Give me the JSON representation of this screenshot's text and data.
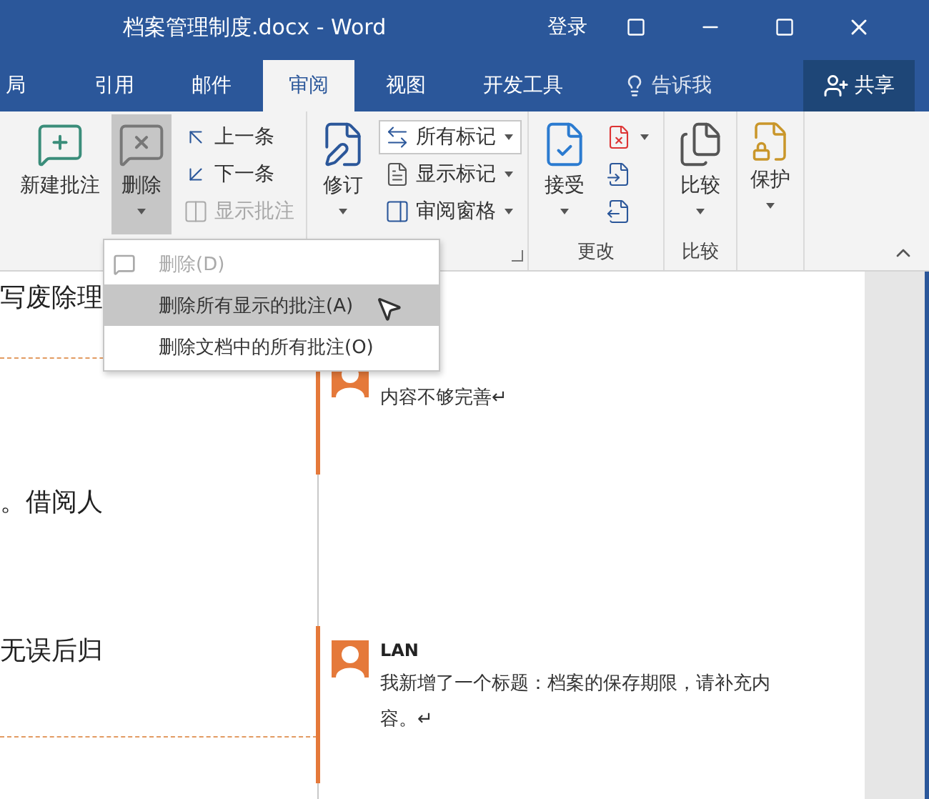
{
  "window": {
    "title": "档案管理制度.docx - Word",
    "sign_in": "登录"
  },
  "tabs": [
    {
      "label": "局",
      "selected": false
    },
    {
      "label": "引用",
      "selected": false
    },
    {
      "label": "邮件",
      "selected": false
    },
    {
      "label": "审阅",
      "selected": true
    },
    {
      "label": "视图",
      "selected": false
    },
    {
      "label": "开发工具",
      "selected": false
    }
  ],
  "tell_me": "告诉我",
  "share": "共享",
  "ribbon": {
    "groups": [
      {
        "items": [
          {
            "kind": "large",
            "label": "新建批注",
            "pressed": false,
            "dropdown": false
          },
          {
            "kind": "large",
            "label": "删除",
            "pressed": true,
            "dropdown": true
          },
          {
            "kind": "stack",
            "entries": [
              {
                "label": "上一条",
                "disabled": false
              },
              {
                "label": "下一条",
                "disabled": false
              },
              {
                "label": "显示批注",
                "disabled": true
              }
            ]
          }
        ]
      },
      {
        "launcher": true,
        "items": [
          {
            "kind": "large",
            "label": "修订",
            "pressed": false,
            "dropdown": true
          },
          {
            "kind": "stack",
            "entries": [
              {
                "label": "所有标记",
                "select": true,
                "disabled": false
              },
              {
                "label": "显示标记",
                "select": false,
                "disabled": false
              },
              {
                "label": "审阅窗格",
                "select": false,
                "disabled": false
              }
            ]
          }
        ]
      },
      {
        "label": "更改",
        "items": [
          {
            "kind": "large",
            "label": "接受",
            "pressed": false,
            "dropdown": true
          },
          {
            "kind": "icons",
            "entries": [
              {
                "dropdown": true
              },
              {
                "dropdown": false
              },
              {
                "dropdown": false
              }
            ]
          }
        ]
      },
      {
        "label": "比较",
        "items": [
          {
            "kind": "large",
            "label": "比较",
            "pressed": false,
            "dropdown": true
          }
        ]
      },
      {
        "items": [
          {
            "kind": "large",
            "label": "保护",
            "pressed": false,
            "dropdown": true
          }
        ]
      }
    ]
  },
  "menu": [
    {
      "label": "删除(D)",
      "icon": true,
      "disabled": true,
      "selected": false
    },
    {
      "label": "删除所有显示的批注(A)",
      "icon": false,
      "disabled": false,
      "selected": true
    },
    {
      "label": "删除文档中的所有批注(O)",
      "icon": false,
      "disabled": false,
      "selected": false
    }
  ],
  "page_lines": [
    "写废除理",
    "。借阅人",
    "无误后归"
  ],
  "comments": [
    {
      "text": "内容不够完善↵"
    },
    {
      "author": "LAN",
      "text": "我新增了一个标题：档案的保存期限，请补充内容。↵"
    }
  ]
}
